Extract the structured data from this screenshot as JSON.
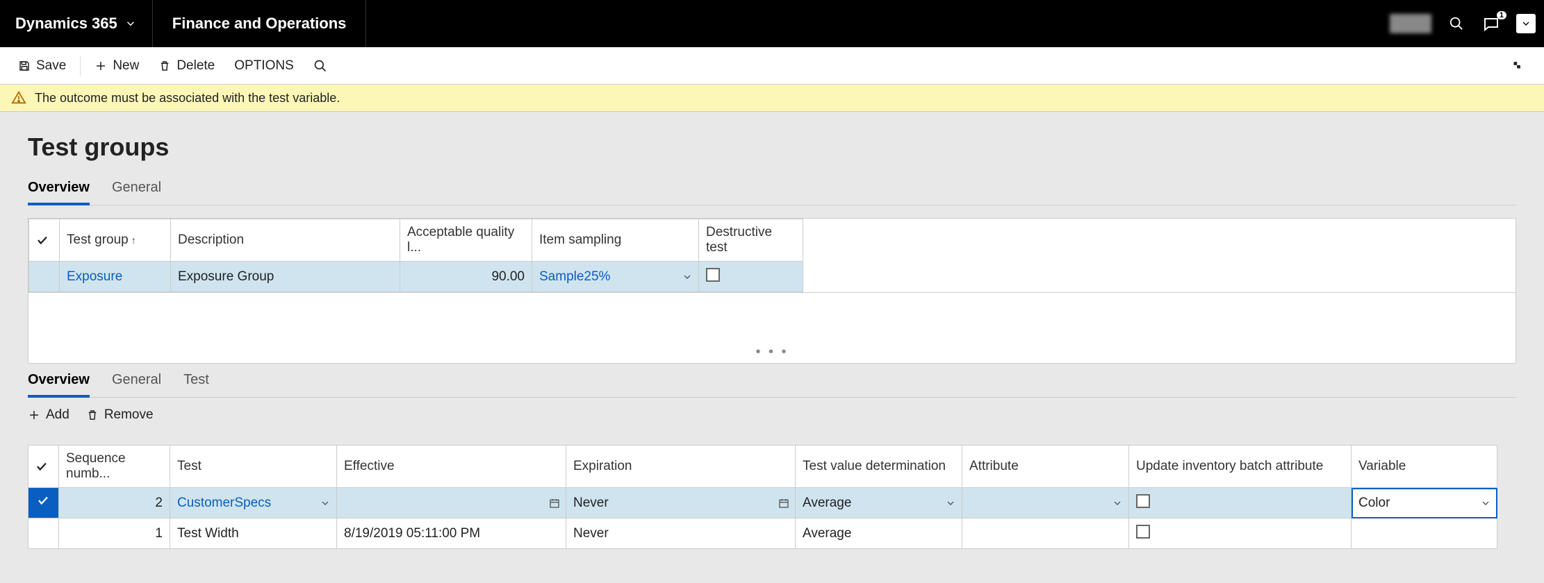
{
  "brand": "Dynamics 365",
  "module": "Finance and Operations",
  "notification_count": "1",
  "actions": {
    "save": "Save",
    "new": "New",
    "delete": "Delete",
    "options": "OPTIONS"
  },
  "warning": "The outcome must be associated with the test variable.",
  "page_title": "Test groups",
  "tabs_top": {
    "overview": "Overview",
    "general": "General"
  },
  "grid1": {
    "headers": {
      "test_group": "Test group",
      "description": "Description",
      "aql": "Acceptable quality l...",
      "item_sampling": "Item sampling",
      "destructive": "Destructive test"
    },
    "row": {
      "test_group": "Exposure",
      "description": "Exposure Group",
      "aql": "90.00",
      "item_sampling": "Sample25%"
    }
  },
  "tabs_bottom": {
    "overview": "Overview",
    "general": "General",
    "test": "Test"
  },
  "sub_actions": {
    "add": "Add",
    "remove": "Remove"
  },
  "grid2": {
    "headers": {
      "seq": "Sequence numb...",
      "test": "Test",
      "effective": "Effective",
      "expiration": "Expiration",
      "tvd": "Test value determination",
      "attribute": "Attribute",
      "update_attr": "Update inventory batch attribute",
      "variable": "Variable"
    },
    "rows": [
      {
        "seq": "2",
        "test": "CustomerSpecs",
        "effective": "",
        "expiration": "Never",
        "tvd": "Average",
        "attribute": "",
        "variable": "Color"
      },
      {
        "seq": "1",
        "test": "Test Width",
        "effective": "8/19/2019 05:11:00 PM",
        "expiration": "Never",
        "tvd": "Average",
        "attribute": "",
        "variable": ""
      }
    ]
  }
}
